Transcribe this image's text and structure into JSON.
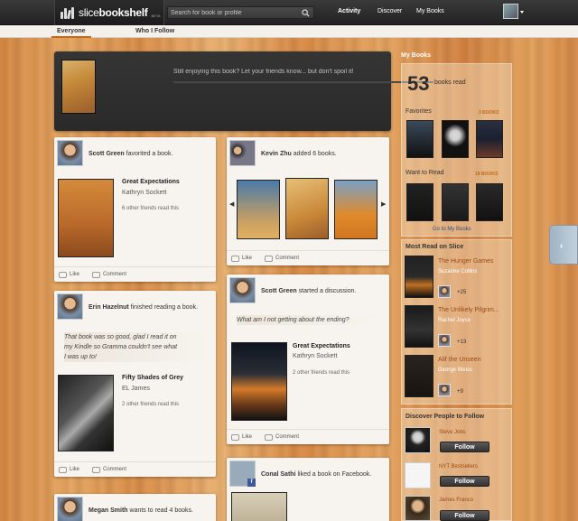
{
  "brand": {
    "name_light": "slice",
    "name_bold": "bookshelf",
    "beta": "BETA"
  },
  "search": {
    "placeholder": "Search for book or profile"
  },
  "nav": {
    "activity": "Activity",
    "discover": "Discover",
    "my_books": "My Books"
  },
  "subtabs": {
    "everyone": "Everyone",
    "who_i_follow": "Who I Follow"
  },
  "composer": {
    "placeholder": "Still enjoying this book? Let your friends know... but don't spoil it!"
  },
  "feed": {
    "card1": {
      "user": "Scott Green",
      "action": " favorited a book.",
      "book_title": "Great Expectations",
      "book_author": "Kathryn Sockett",
      "meta": "6 other friends read this"
    },
    "card2": {
      "user": "Erin Hazelnut",
      "action": " finished reading a book.",
      "quote_lines": [
        "That book was so good, glad I read it on",
        "my Kindle so Gramma couldn't see what",
        "I was up to!"
      ],
      "book_title": "Fifty Shades of Grey",
      "book_author": "EL James",
      "meta": "2 other friends read this"
    },
    "card3": {
      "user": "Megan Smith",
      "action": " wants to read 4 books."
    },
    "card4": {
      "user": "Kevin Zhu",
      "action": " added 6 books."
    },
    "card5": {
      "user": "Scott Green",
      "action": " started a discussion.",
      "quote": "What am I not getting about the ending?",
      "book_title": "Great Expectations",
      "book_author": "Kathryn Sockett",
      "meta": "2 other friends read this"
    },
    "card6": {
      "user": "Conal Sathi",
      "action": " liked a book on Facebook."
    },
    "like_label": "Like",
    "comment_label": "Comment"
  },
  "sidebar": {
    "my_books_title": "My Books",
    "books_read_count": "53",
    "books_read_label": "books read",
    "favorites_label": "Favorites",
    "favorites_count": "3 BOOKS",
    "want_to_read_label": "Want to Read",
    "want_to_read_count": "18 BOOKS",
    "go_to_books": "Go to My Books",
    "most_read_title": "Most Read on Slice",
    "most_read": [
      {
        "title": "The Hunger Games",
        "author": "Suzanne Collins",
        "plus": "+25"
      },
      {
        "title": "The Unlikely Pilgrim...",
        "author": "Rachel Joyce",
        "plus": "+13"
      },
      {
        "title": "Alif the Unseen",
        "author": "George Weiss",
        "plus": "+9"
      }
    ],
    "discover_title": "Discover People to Follow",
    "people": [
      {
        "name": "Steve Jobs",
        "button": "Follow"
      },
      {
        "name": "NYT Bestsellers",
        "button": "Follow"
      },
      {
        "name": "James Franco",
        "button": "Follow"
      }
    ]
  },
  "colors": {
    "accent": "#c06a1e",
    "topbar": "#2a2a2a",
    "link": "#2d4f7e"
  }
}
